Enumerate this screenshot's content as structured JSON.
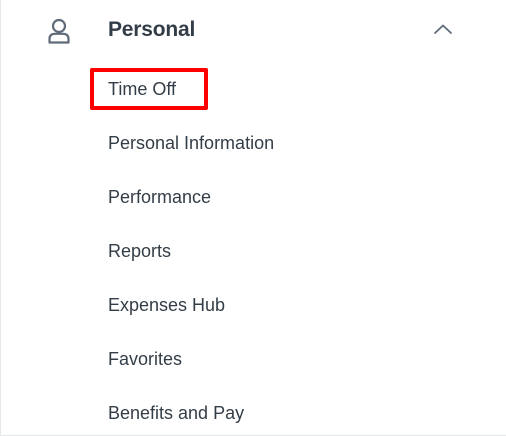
{
  "section": {
    "title": "Personal",
    "icon": "person-icon",
    "expanded": true,
    "toggle_icon": "chevron-up-icon"
  },
  "menu": {
    "items": [
      {
        "label": "Time Off",
        "highlighted": true
      },
      {
        "label": "Personal Information"
      },
      {
        "label": "Performance"
      },
      {
        "label": "Reports"
      },
      {
        "label": "Expenses Hub"
      },
      {
        "label": "Favorites"
      },
      {
        "label": "Benefits and Pay"
      }
    ]
  },
  "colors": {
    "text": "#333d47",
    "highlight": "#ff0000",
    "icon": "#5f6b78"
  }
}
